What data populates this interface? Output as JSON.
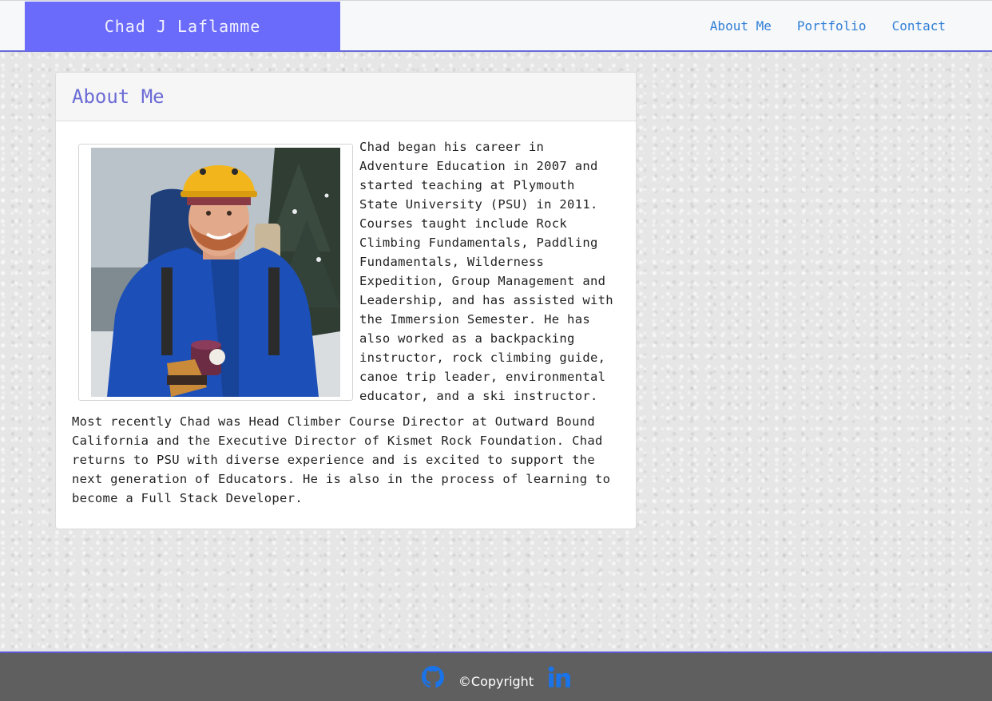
{
  "header": {
    "brand": "Chad J Laflamme",
    "nav": [
      {
        "label": "About Me"
      },
      {
        "label": "Portfolio"
      },
      {
        "label": "Contact"
      }
    ]
  },
  "about": {
    "title": "About Me",
    "paragraph1": "Chad began his career in Adventure Education in 2007 and started teaching at Plymouth State University (PSU) in 2011. Courses taught include Rock Climbing Fundamentals, Paddling Fundamentals, Wilderness Expedition, Group Management and Leadership, and has assisted with the Immersion Semester. He has also worked as a backpacking instructor, rock climbing guide, canoe trip leader, environmental educator, and a ski instructor.",
    "paragraph2": "Most recently Chad was Head Climber Course Director at Outward Bound California and the Executive Director of Kismet Rock Foundation. Chad returns to PSU with diverse experience and is excited to support the next generation of Educators. He is also in the process of learning to become a Full Stack Developer."
  },
  "footer": {
    "copyright": "©Copyright",
    "icons": [
      "github-icon",
      "linkedin-icon"
    ]
  },
  "colors": {
    "brand_bg": "#6b6bfb",
    "accent": "#6b6bd6",
    "link": "#2f7fd6",
    "footer_bg": "#5f5f5f",
    "social_icon": "#1a73e8"
  }
}
